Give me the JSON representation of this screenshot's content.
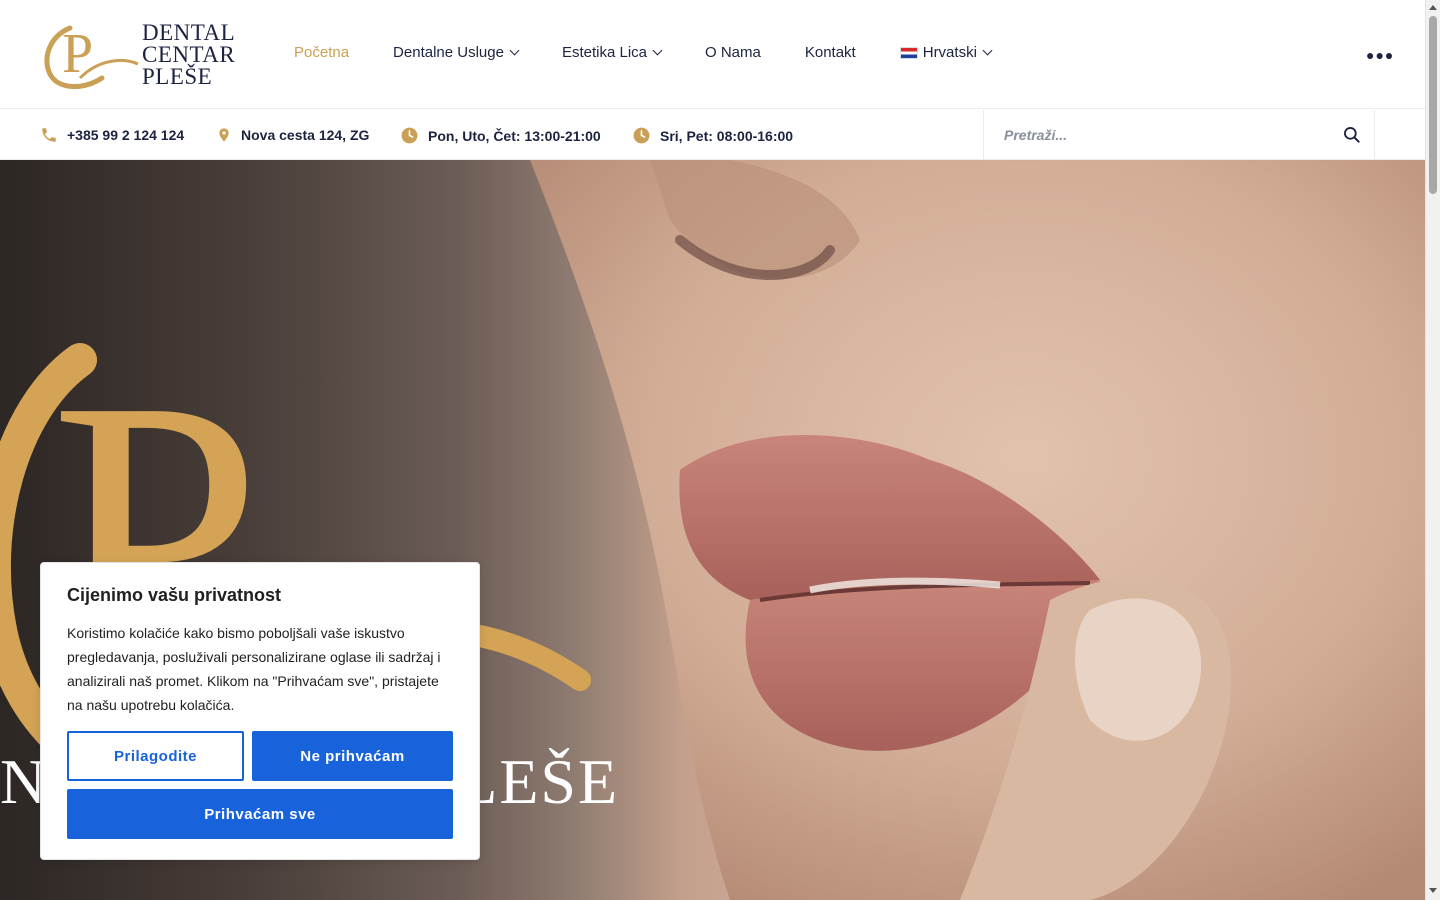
{
  "brand": {
    "line1": "DENTAL",
    "line2": "CENTAR",
    "line3": "PLEŠE",
    "gold": "#c9a055",
    "navy": "#1c2340"
  },
  "nav": {
    "items": [
      {
        "label": "Početna",
        "active": true,
        "dropdown": false
      },
      {
        "label": "Dentalne Usluge",
        "active": false,
        "dropdown": true
      },
      {
        "label": "Estetika Lica",
        "active": false,
        "dropdown": true
      },
      {
        "label": "O Nama",
        "active": false,
        "dropdown": false
      },
      {
        "label": "Kontakt",
        "active": false,
        "dropdown": false
      }
    ],
    "language": "Hrvatski",
    "more_icon": "ellipsis-icon"
  },
  "info": {
    "phone": "+385 99 2 124 124",
    "address": "Nova cesta 124, ZG",
    "hours1": "Pon, Uto, Čet: 13:00-21:00",
    "hours2": "Sri, Pet: 08:00-16:00"
  },
  "search": {
    "placeholder": "Pretraži...",
    "icon": "search-icon"
  },
  "hero": {
    "title_left": "N",
    "title_right": "LEŠE"
  },
  "cookie": {
    "title": "Cijenimo vašu privatnost",
    "text": "Koristimo kolačiće kako bismo poboljšali vaše iskustvo pregledavanja, posluživali personalizirane oglase ili sadržaj i analizirali naš promet. Klikom na \"Prihvaćam sve\", pristajete na našu upotrebu kolačića.",
    "customize": "Prilagodite",
    "reject": "Ne prihvaćam",
    "accept": "Prihvaćam sve",
    "button_color": "#1863dc"
  }
}
